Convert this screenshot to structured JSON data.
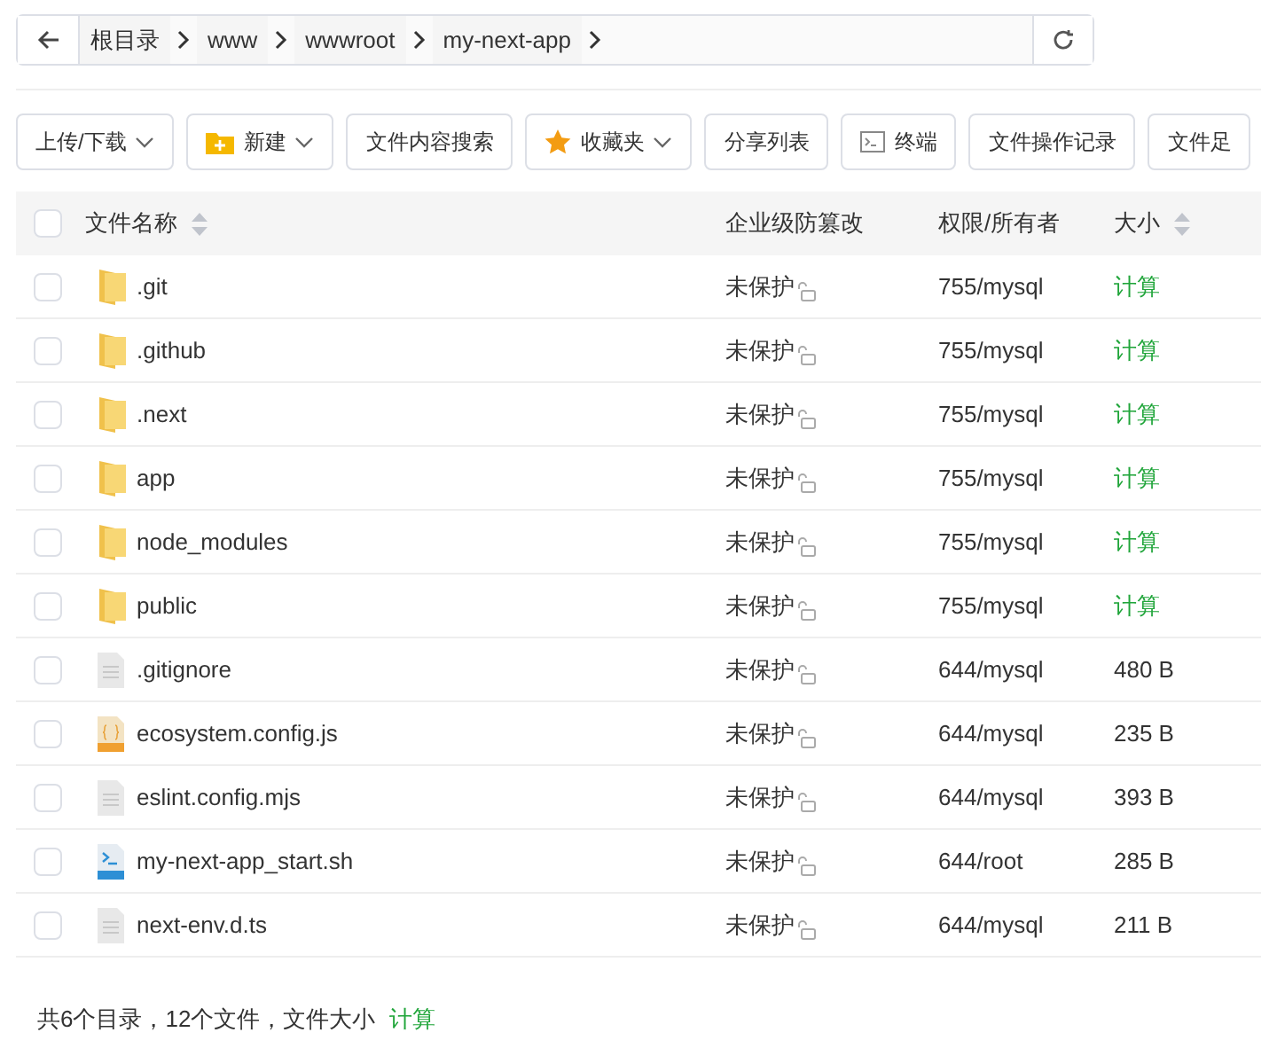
{
  "breadcrumb": [
    "根目录",
    "www",
    "wwwroot",
    "my-next-app"
  ],
  "toolbar": [
    {
      "label": "上传/下载",
      "dropdown": true
    },
    {
      "label": "新建",
      "dropdown": true
    },
    {
      "label": "文件内容搜索",
      "dropdown": false
    },
    {
      "label": "收藏夹",
      "dropdown": true
    },
    {
      "label": "分享列表",
      "dropdown": false
    },
    {
      "label": "终端",
      "dropdown": false
    },
    {
      "label": "文件操作记录",
      "dropdown": false
    },
    {
      "label": "文件足",
      "dropdown": false
    }
  ],
  "table": {
    "select_all": {
      "checked": false
    },
    "columns": [
      "文件名称",
      "企业级防篡改",
      "权限/所有者",
      "大小"
    ],
    "rows": [
      {
        "kind": "folder",
        "name": ".git",
        "protection": "未保护",
        "permission": "755/mysql",
        "size": "计算",
        "checked": false
      },
      {
        "kind": "folder",
        "name": ".github",
        "protection": "未保护",
        "permission": "755/mysql",
        "size": "计算",
        "checked": false
      },
      {
        "kind": "folder",
        "name": ".next",
        "protection": "未保护",
        "permission": "755/mysql",
        "size": "计算",
        "checked": false
      },
      {
        "kind": "folder",
        "name": "app",
        "protection": "未保护",
        "permission": "755/mysql",
        "size": "计算",
        "checked": false
      },
      {
        "kind": "folder",
        "name": "node_modules",
        "protection": "未保护",
        "permission": "755/mysql",
        "size": "计算",
        "checked": false
      },
      {
        "kind": "folder",
        "name": "public",
        "protection": "未保护",
        "permission": "755/mysql",
        "size": "计算",
        "checked": false
      },
      {
        "kind": "text",
        "name": ".gitignore",
        "protection": "未保护",
        "permission": "644/mysql",
        "size": "480 B",
        "checked": false
      },
      {
        "kind": "js",
        "name": "ecosystem.config.js",
        "protection": "未保护",
        "permission": "644/mysql",
        "size": "235 B",
        "checked": false
      },
      {
        "kind": "text",
        "name": "eslint.config.mjs",
        "protection": "未保护",
        "permission": "644/mysql",
        "size": "393 B",
        "checked": false
      },
      {
        "kind": "shell",
        "name": "my-next-app_start.sh",
        "protection": "未保护",
        "permission": "644/root",
        "size": "285 B",
        "checked": false
      },
      {
        "kind": "text",
        "name": "next-env.d.ts",
        "protection": "未保护",
        "permission": "644/mysql",
        "size": "211 B",
        "checked": false
      }
    ]
  },
  "footer": {
    "summary": "共6个目录，12个文件，文件大小",
    "link": "计算"
  }
}
